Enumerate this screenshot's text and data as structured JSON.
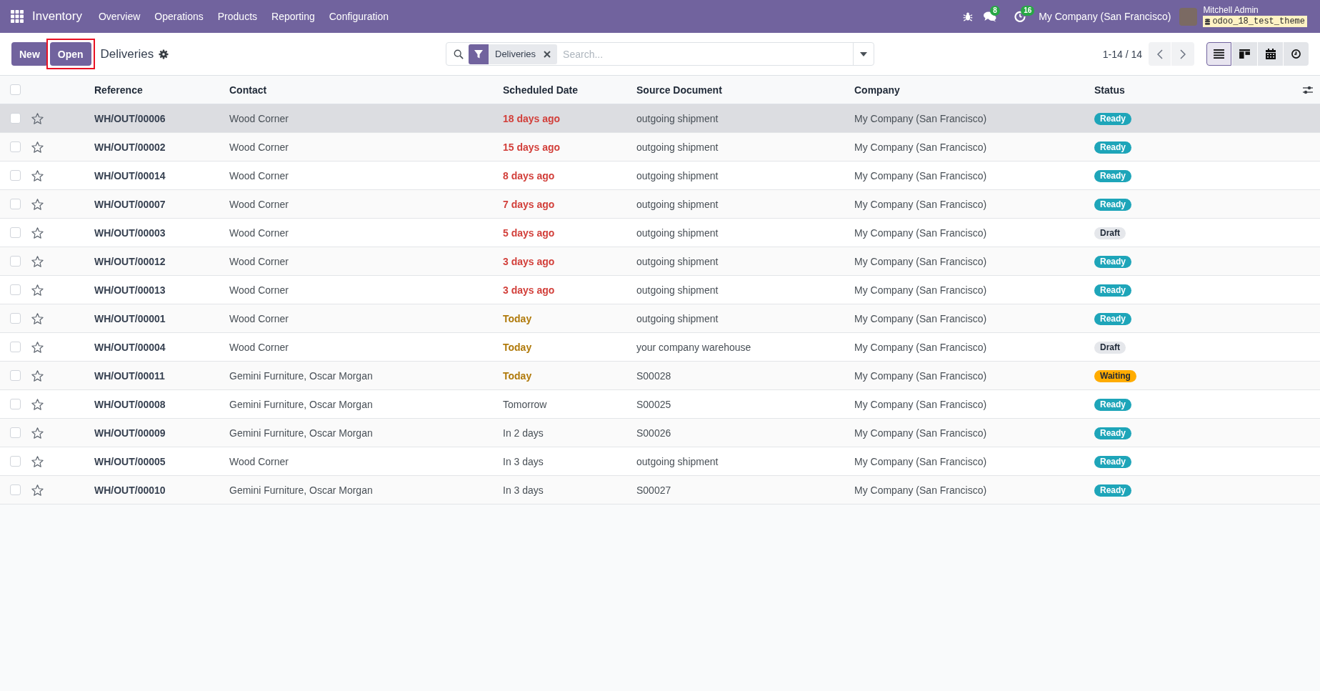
{
  "navbar": {
    "app_name": "Inventory",
    "menu": [
      "Overview",
      "Operations",
      "Products",
      "Reporting",
      "Configuration"
    ],
    "messages_count": "8",
    "activities_count": "16",
    "company": "My Company (San Francisco)",
    "user": {
      "name": "Mitchell Admin",
      "database": "odoo_18_test_theme"
    }
  },
  "control_panel": {
    "buttons": [
      {
        "label": "New",
        "highlighted": false
      },
      {
        "label": "Open",
        "highlighted": true
      }
    ],
    "title": "Deliveries",
    "search": {
      "facets": [
        {
          "label": "Deliveries"
        }
      ],
      "placeholder": "Search..."
    },
    "pager": "1-14 / 14",
    "views": [
      {
        "kind": "list",
        "selected": true
      },
      {
        "kind": "kanban",
        "selected": false
      },
      {
        "kind": "calendar",
        "selected": false
      },
      {
        "kind": "activity",
        "selected": false
      }
    ]
  },
  "table": {
    "all_checked": false,
    "columns": [
      "Reference",
      "Contact",
      "Scheduled Date",
      "Source Document",
      "Company",
      "Status"
    ],
    "rows": [
      {
        "reference": "WH/OUT/00006",
        "contact": "Wood Corner",
        "scheduled_date": "18 days ago",
        "overdue": true,
        "due_today": false,
        "source_document": "outgoing shipment",
        "company": "My Company (San Francisco)",
        "status": {
          "label": "Ready",
          "color": "#1ea5b9"
        },
        "checked": false,
        "starred": false,
        "hovered": true
      },
      {
        "reference": "WH/OUT/00002",
        "contact": "Wood Corner",
        "scheduled_date": "15 days ago",
        "overdue": true,
        "due_today": false,
        "source_document": "outgoing shipment",
        "company": "My Company (San Francisco)",
        "status": {
          "label": "Ready",
          "color": "#1ea5b9"
        },
        "checked": false,
        "starred": false,
        "hovered": false
      },
      {
        "reference": "WH/OUT/00014",
        "contact": "Wood Corner",
        "scheduled_date": "8 days ago",
        "overdue": true,
        "due_today": false,
        "source_document": "outgoing shipment",
        "company": "My Company (San Francisco)",
        "status": {
          "label": "Ready",
          "color": "#1ea5b9"
        },
        "checked": false,
        "starred": false,
        "hovered": false
      },
      {
        "reference": "WH/OUT/00007",
        "contact": "Wood Corner",
        "scheduled_date": "7 days ago",
        "overdue": true,
        "due_today": false,
        "source_document": "outgoing shipment",
        "company": "My Company (San Francisco)",
        "status": {
          "label": "Ready",
          "color": "#1ea5b9"
        },
        "checked": false,
        "starred": false,
        "hovered": false
      },
      {
        "reference": "WH/OUT/00003",
        "contact": "Wood Corner",
        "scheduled_date": "5 days ago",
        "overdue": true,
        "due_today": false,
        "source_document": "outgoing shipment",
        "company": "My Company (San Francisco)",
        "status": {
          "label": "Draft",
          "color": "#e5e7eb"
        },
        "checked": false,
        "starred": false,
        "hovered": false
      },
      {
        "reference": "WH/OUT/00012",
        "contact": "Wood Corner",
        "scheduled_date": "3 days ago",
        "overdue": true,
        "due_today": false,
        "source_document": "outgoing shipment",
        "company": "My Company (San Francisco)",
        "status": {
          "label": "Ready",
          "color": "#1ea5b9"
        },
        "checked": false,
        "starred": false,
        "hovered": false
      },
      {
        "reference": "WH/OUT/00013",
        "contact": "Wood Corner",
        "scheduled_date": "3 days ago",
        "overdue": true,
        "due_today": false,
        "source_document": "outgoing shipment",
        "company": "My Company (San Francisco)",
        "status": {
          "label": "Ready",
          "color": "#1ea5b9"
        },
        "checked": false,
        "starred": false,
        "hovered": false
      },
      {
        "reference": "WH/OUT/00001",
        "contact": "Wood Corner",
        "scheduled_date": "Today",
        "overdue": false,
        "due_today": true,
        "source_document": "outgoing shipment",
        "company": "My Company (San Francisco)",
        "status": {
          "label": "Ready",
          "color": "#1ea5b9"
        },
        "checked": false,
        "starred": false,
        "hovered": false
      },
      {
        "reference": "WH/OUT/00004",
        "contact": "Wood Corner",
        "scheduled_date": "Today",
        "overdue": false,
        "due_today": true,
        "source_document": "your company warehouse",
        "company": "My Company (San Francisco)",
        "status": {
          "label": "Draft",
          "color": "#e5e7eb"
        },
        "checked": false,
        "starred": false,
        "hovered": false
      },
      {
        "reference": "WH/OUT/00011",
        "contact": "Gemini Furniture, Oscar Morgan",
        "scheduled_date": "Today",
        "overdue": false,
        "due_today": true,
        "source_document": "S00028",
        "company": "My Company (San Francisco)",
        "status": {
          "label": "Waiting",
          "color": "#ffac00"
        },
        "checked": false,
        "starred": false,
        "hovered": false
      },
      {
        "reference": "WH/OUT/00008",
        "contact": "Gemini Furniture, Oscar Morgan",
        "scheduled_date": "Tomorrow",
        "overdue": false,
        "due_today": false,
        "source_document": "S00025",
        "company": "My Company (San Francisco)",
        "status": {
          "label": "Ready",
          "color": "#1ea5b9"
        },
        "checked": false,
        "starred": false,
        "hovered": false
      },
      {
        "reference": "WH/OUT/00009",
        "contact": "Gemini Furniture, Oscar Morgan",
        "scheduled_date": "In 2 days",
        "overdue": false,
        "due_today": false,
        "source_document": "S00026",
        "company": "My Company (San Francisco)",
        "status": {
          "label": "Ready",
          "color": "#1ea5b9"
        },
        "checked": false,
        "starred": false,
        "hovered": false
      },
      {
        "reference": "WH/OUT/00005",
        "contact": "Wood Corner",
        "scheduled_date": "In 3 days",
        "overdue": false,
        "due_today": false,
        "source_document": "outgoing shipment",
        "company": "My Company (San Francisco)",
        "status": {
          "label": "Ready",
          "color": "#1ea5b9"
        },
        "checked": false,
        "starred": false,
        "hovered": false
      },
      {
        "reference": "WH/OUT/00010",
        "contact": "Gemini Furniture, Oscar Morgan",
        "scheduled_date": "In 3 days",
        "overdue": false,
        "due_today": false,
        "source_document": "S00027",
        "company": "My Company (San Francisco)",
        "status": {
          "label": "Ready",
          "color": "#1ea5b9"
        },
        "checked": false,
        "starred": false,
        "hovered": false
      }
    ]
  }
}
